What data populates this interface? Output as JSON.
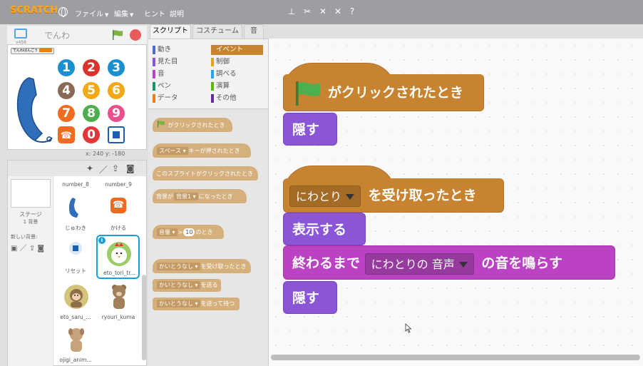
{
  "menubar": {
    "logo": "SCRATCH",
    "file": "ファイル",
    "edit": "編集",
    "tips": "ヒント",
    "about": "説明"
  },
  "stage": {
    "version": "v458",
    "sprite_name": "でんわ",
    "monitor_label": "でんわばんごう",
    "coords": "x: 240  y: -180",
    "numbers": [
      "1",
      "2",
      "3",
      "4",
      "5",
      "6",
      "7",
      "8",
      "9",
      "0"
    ],
    "colors": {
      "n1": "#1a8fd1",
      "n2": "#d9342b",
      "n3": "#1a8fd1",
      "n4": "#8a6a55",
      "n5": "#f2a818",
      "n6": "#f2a818",
      "n7": "#ef6b1f",
      "n8": "#4cae4c",
      "n9": "#e84f8c",
      "call": "#ef6b1f",
      "n0": "#e3363b",
      "hangup": "#1a5fb4",
      "phone": "#2f6fba"
    }
  },
  "sprites_pane": {
    "stage_label": "ステージ",
    "stage_bg_count": "1 背景",
    "new_backdrop": "新しい背景:",
    "sprites": [
      {
        "name": "number_8"
      },
      {
        "name": "number_9"
      },
      {
        "name": "じゅわき"
      },
      {
        "name": "かける"
      },
      {
        "name": "リセット"
      },
      {
        "name": "eto_tori_tr..."
      },
      {
        "name": "eto_saru_..."
      },
      {
        "name": "ryouri_kuma"
      },
      {
        "name": "ojigi_anim..."
      }
    ]
  },
  "tabs": {
    "scripts": "スクリプト",
    "costumes": "コスチューム",
    "sounds": "音"
  },
  "categories": {
    "motion": "動き",
    "looks": "見た目",
    "sound": "音",
    "pen": "ペン",
    "data": "データ",
    "events": "イベント",
    "control": "制御",
    "sensing": "調べる",
    "operators": "演算",
    "more": "その他"
  },
  "palette": {
    "flag_clicked": "がクリックされたとき",
    "key_part1": "スペース",
    "key_part2": "キーが押されたとき",
    "sprite_clicked": "このスプライトがクリックされたとき",
    "backdrop_part1": "背景が",
    "backdrop_drop": "背景1",
    "backdrop_part2": "になったとき",
    "sensor_drop": "音量",
    "sensor_op": ">",
    "sensor_value": "10",
    "sensor_tail": "のとき",
    "receive_drop": "かいとうなし",
    "receive_tail": "を受け取ったとき",
    "broadcast_drop": "かいとうなし",
    "broadcast_tail": "を送る",
    "broadcast_wait_drop": "かいとうなし",
    "broadcast_wait_tail": "を送って待つ"
  },
  "script": {
    "hat1": "がクリックされたとき",
    "hide1": "隠す",
    "hat2_drop": "にわとり",
    "hat2_tail": "を受け取ったとき",
    "show": "表示する",
    "play_head": "終わるまで",
    "play_drop": "にわとりの 音声",
    "play_tail": "の音を鳴らす",
    "hide2": "隠す"
  }
}
